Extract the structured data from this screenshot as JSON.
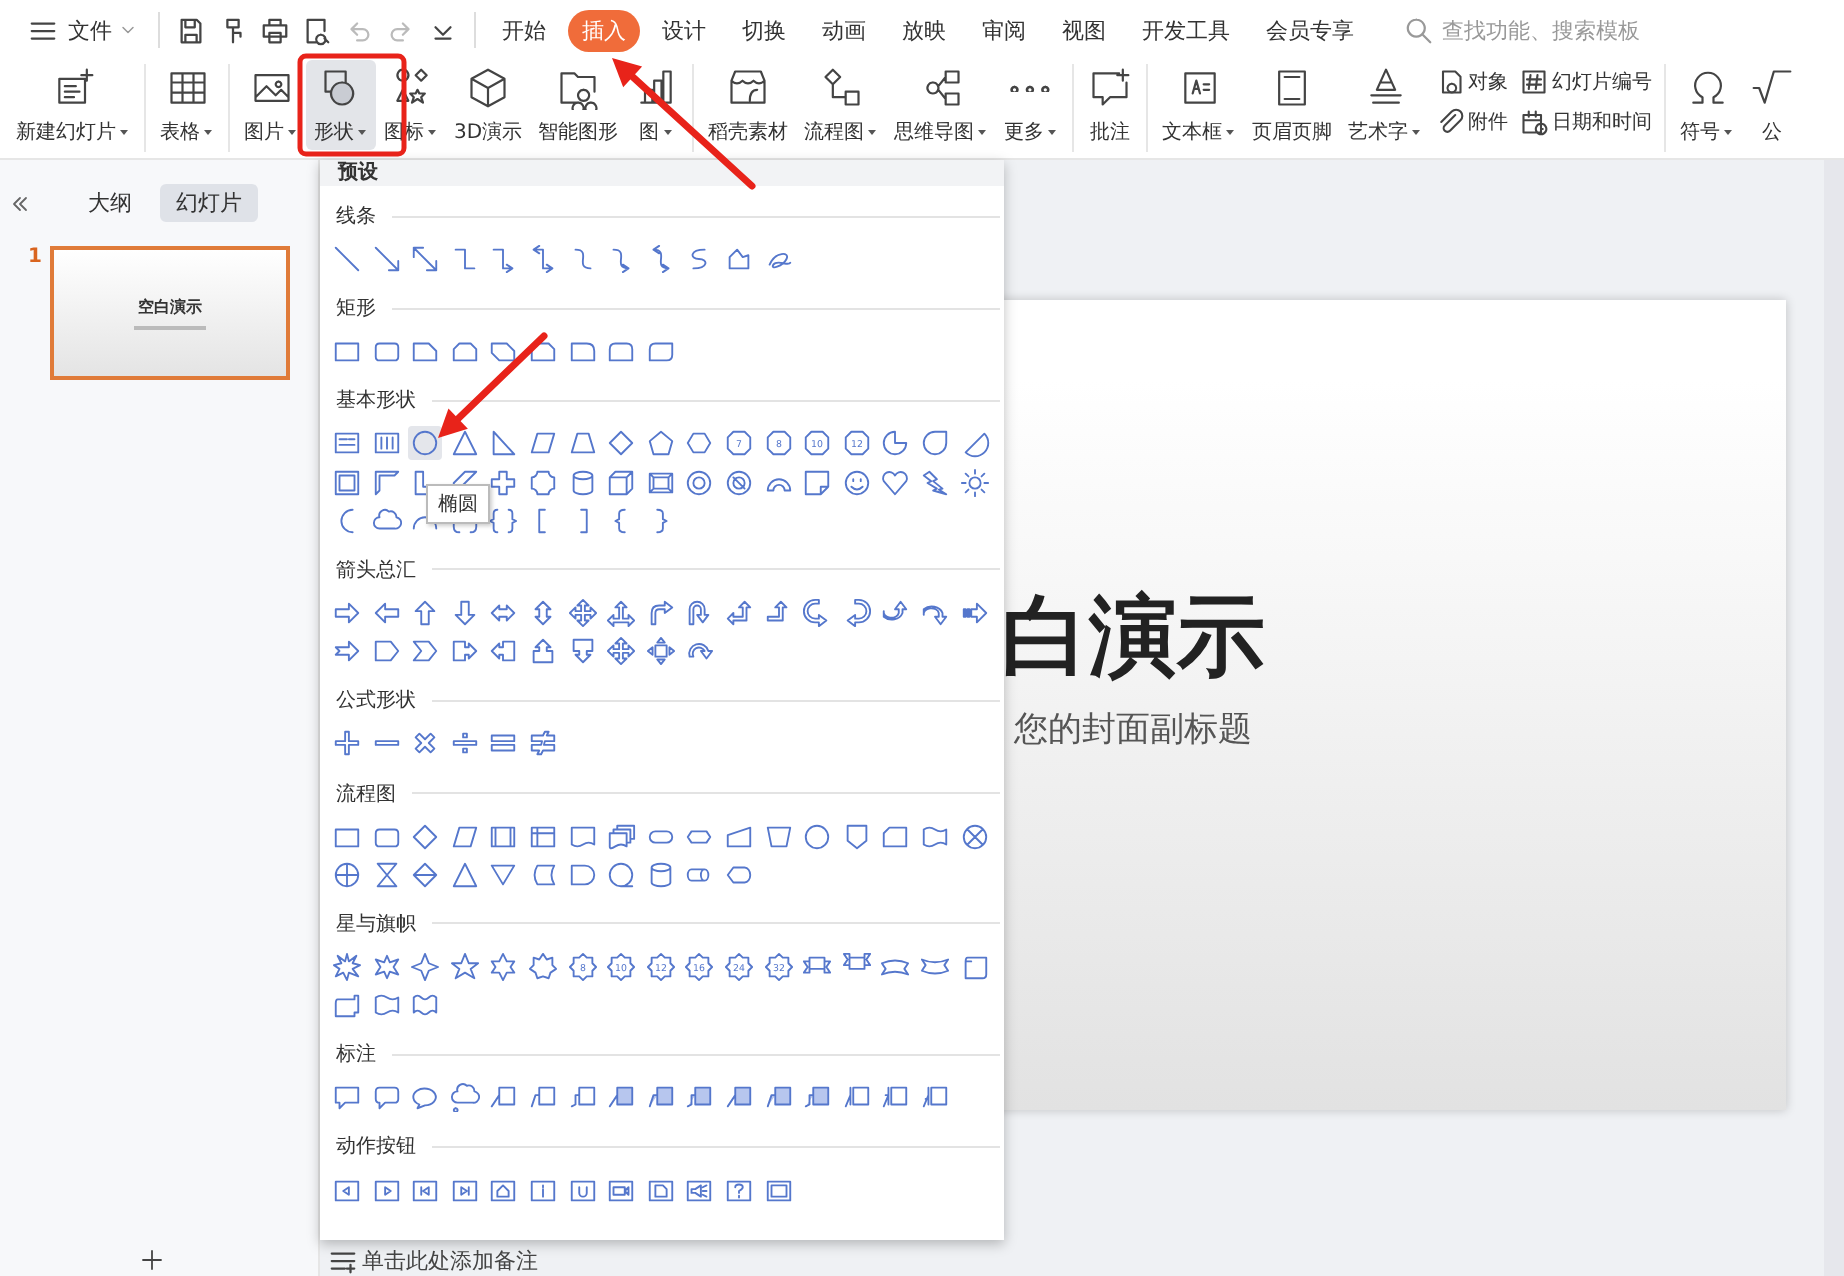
{
  "menu": {
    "label": "文件"
  },
  "quick_access": [
    {
      "disabled": false
    },
    {
      "disabled": false
    },
    {
      "disabled": false
    },
    {
      "disabled": false
    },
    {
      "disabled": true
    },
    {
      "disabled": true
    },
    {
      "disabled": false
    }
  ],
  "tabs": [
    {
      "label": "开始",
      "selected": false
    },
    {
      "label": "插入",
      "selected": true
    },
    {
      "label": "设计",
      "selected": false
    },
    {
      "label": "切换",
      "selected": false
    },
    {
      "label": "动画",
      "selected": false
    },
    {
      "label": "放映",
      "selected": false
    },
    {
      "label": "审阅",
      "selected": false
    },
    {
      "label": "视图",
      "selected": false
    },
    {
      "label": "开发工具",
      "selected": false
    },
    {
      "label": "会员专享",
      "selected": false
    }
  ],
  "search": {
    "placeholder": "查找功能、搜索模板"
  },
  "ribbon": {
    "items": [
      {
        "kind": "large",
        "label": "新建幻灯片",
        "dropdown": true,
        "active": false
      },
      {
        "kind": "separator"
      },
      {
        "kind": "large",
        "label": "表格",
        "dropdown": true,
        "active": false
      },
      {
        "kind": "separator"
      },
      {
        "kind": "large",
        "label": "图片",
        "dropdown": true,
        "active": false
      },
      {
        "kind": "large",
        "label": "形状",
        "dropdown": true,
        "active": true
      },
      {
        "kind": "large",
        "label": "图标",
        "dropdown": true,
        "active": false
      },
      {
        "kind": "large",
        "label": "3D演示",
        "dropdown": false,
        "active": false
      },
      {
        "kind": "large",
        "label": "智能图形",
        "dropdown": false,
        "active": false
      },
      {
        "kind": "large",
        "label": "图",
        "dropdown": true,
        "active": false
      },
      {
        "kind": "separator"
      },
      {
        "kind": "large",
        "label": "稻壳素材",
        "dropdown": false,
        "active": false
      },
      {
        "kind": "large",
        "label": "流程图",
        "dropdown": true,
        "active": false
      },
      {
        "kind": "large",
        "label": "思维导图",
        "dropdown": true,
        "active": false
      },
      {
        "kind": "large",
        "label": "更多",
        "dropdown": true,
        "active": false
      },
      {
        "kind": "separator"
      },
      {
        "kind": "large",
        "label": "批注",
        "dropdown": false,
        "active": false
      },
      {
        "kind": "separator"
      },
      {
        "kind": "large",
        "label": "文本框",
        "dropdown": true,
        "active": false
      },
      {
        "kind": "large",
        "label": "页眉页脚",
        "dropdown": false,
        "active": false
      },
      {
        "kind": "large",
        "label": "艺术字",
        "dropdown": true,
        "active": false
      },
      {
        "kind": "pair",
        "items": [
          {
            "label": "对象"
          },
          {
            "label": "附件"
          }
        ]
      },
      {
        "kind": "pair",
        "items": [
          {
            "label": "幻灯片编号"
          },
          {
            "label": "日期和时间"
          }
        ]
      },
      {
        "kind": "separator"
      },
      {
        "kind": "large",
        "label": "符号",
        "dropdown": true,
        "active": false
      },
      {
        "kind": "large",
        "label": "公",
        "dropdown": false,
        "active": false
      }
    ]
  },
  "side_panel": {
    "tabs": [
      {
        "label": "大纲",
        "selected": false
      },
      {
        "label": "幻灯片",
        "selected": true
      }
    ],
    "slides": [
      {
        "number": "1",
        "title": "空白演示",
        "selected": true
      }
    ]
  },
  "slide": {
    "title": "白演示",
    "subtitle": "您的封面副标题"
  },
  "notes": {
    "placeholder": "单击此处添加备注"
  },
  "shapes_panel": {
    "header": "预设",
    "tooltip": "椭圆",
    "sections": [
      {
        "label": "线条",
        "shapes": [
          {
            "kind": "line"
          },
          {
            "kind": "arrow-line"
          },
          {
            "kind": "double-arrow-line"
          },
          {
            "kind": "elbow"
          },
          {
            "kind": "elbow-arrow"
          },
          {
            "kind": "elbow-double-arrow"
          },
          {
            "kind": "curve"
          },
          {
            "kind": "curve-arrow"
          },
          {
            "kind": "curve-double-arrow"
          },
          {
            "kind": "s-curve"
          },
          {
            "kind": "freeform"
          },
          {
            "kind": "scribble"
          }
        ]
      },
      {
        "label": "矩形",
        "shapes": [
          {
            "kind": "rect"
          },
          {
            "kind": "round-rect"
          },
          {
            "kind": "snip-rect"
          },
          {
            "kind": "snip-two"
          },
          {
            "kind": "snip-diag"
          },
          {
            "kind": "round-snip"
          },
          {
            "kind": "round-one"
          },
          {
            "kind": "round-two"
          },
          {
            "kind": "round-diag"
          }
        ]
      },
      {
        "label": "基本形状",
        "shapes": [
          {
            "kind": "text-box"
          },
          {
            "kind": "vertical-text-box"
          },
          {
            "kind": "circle",
            "hovered": true
          },
          {
            "kind": "triangle"
          },
          {
            "kind": "right-triangle"
          },
          {
            "kind": "parallelogram"
          },
          {
            "kind": "trapezoid"
          },
          {
            "kind": "diamond"
          },
          {
            "kind": "pentagon"
          },
          {
            "kind": "hexagon"
          },
          {
            "kind": "badge",
            "label": "7"
          },
          {
            "kind": "badge",
            "label": "8"
          },
          {
            "kind": "badge",
            "label": "10"
          },
          {
            "kind": "badge",
            "label": "12"
          },
          {
            "kind": "pie"
          },
          {
            "kind": "teardrop"
          },
          {
            "kind": "chord"
          },
          {
            "kind": "frame"
          },
          {
            "kind": "half-frame"
          },
          {
            "kind": "l-shape"
          },
          {
            "kind": "diagonal-stripe"
          },
          {
            "kind": "plus-shape"
          },
          {
            "kind": "plaque"
          },
          {
            "kind": "can"
          },
          {
            "kind": "cube"
          },
          {
            "kind": "bevel"
          },
          {
            "kind": "donut"
          },
          {
            "kind": "no-symbol"
          },
          {
            "kind": "block-arc"
          },
          {
            "kind": "folded-corner"
          },
          {
            "kind": "smiley"
          },
          {
            "kind": "heart"
          },
          {
            "kind": "lightning"
          },
          {
            "kind": "sun"
          },
          {
            "kind": "moon"
          },
          {
            "kind": "cloud"
          },
          {
            "kind": "arc"
          },
          {
            "kind": "bracket-pair"
          },
          {
            "kind": "brace-pair"
          },
          {
            "kind": "left-bracket"
          },
          {
            "kind": "right-bracket"
          },
          {
            "kind": "left-brace"
          },
          {
            "kind": "right-brace"
          }
        ]
      },
      {
        "label": "箭头总汇",
        "shapes": [
          {
            "kind": "arrow-right"
          },
          {
            "kind": "arrow-left"
          },
          {
            "kind": "arrow-up"
          },
          {
            "kind": "arrow-down"
          },
          {
            "kind": "arrow-left-right"
          },
          {
            "kind": "arrow-up-down"
          },
          {
            "kind": "arrow-quad"
          },
          {
            "kind": "arrow-three-way"
          },
          {
            "kind": "bent-arrow"
          },
          {
            "kind": "u-turn-arrow"
          },
          {
            "kind": "left-up-arrow"
          },
          {
            "kind": "bent-up-arrow"
          },
          {
            "kind": "curved-right-arrow"
          },
          {
            "kind": "curved-left-arrow"
          },
          {
            "kind": "curved-up-arrow"
          },
          {
            "kind": "curved-down-arrow"
          },
          {
            "kind": "striped-right-arrow"
          },
          {
            "kind": "notched-right-arrow"
          },
          {
            "kind": "pentagon-arrow"
          },
          {
            "kind": "chevron"
          },
          {
            "kind": "callout-right-arrow"
          },
          {
            "kind": "callout-left-arrow"
          },
          {
            "kind": "callout-up-arrow"
          },
          {
            "kind": "callout-down-arrow"
          },
          {
            "kind": "arrow-quad"
          },
          {
            "kind": "callout-quad-arrow"
          },
          {
            "kind": "circular-arrow"
          }
        ]
      },
      {
        "label": "公式形状",
        "shapes": [
          {
            "kind": "plus-sign"
          },
          {
            "kind": "minus-sign"
          },
          {
            "kind": "multiply-sign"
          },
          {
            "kind": "divide-sign"
          },
          {
            "kind": "equal-sign"
          },
          {
            "kind": "not-equal-sign"
          }
        ]
      },
      {
        "label": "流程图",
        "shapes": [
          {
            "kind": "rect"
          },
          {
            "kind": "round-rect"
          },
          {
            "kind": "diamond"
          },
          {
            "kind": "parallelogram"
          },
          {
            "kind": "predefined-process"
          },
          {
            "kind": "internal-storage"
          },
          {
            "kind": "document"
          },
          {
            "kind": "multi-document"
          },
          {
            "kind": "terminator"
          },
          {
            "kind": "prep-hexagon"
          },
          {
            "kind": "manual-input"
          },
          {
            "kind": "manual-op"
          },
          {
            "kind": "circle"
          },
          {
            "kind": "offpage"
          },
          {
            "kind": "card"
          },
          {
            "kind": "punched-tape"
          },
          {
            "kind": "summing-junction"
          },
          {
            "kind": "or-junction"
          },
          {
            "kind": "collate"
          },
          {
            "kind": "sort"
          },
          {
            "kind": "triangle"
          },
          {
            "kind": "triangle-down"
          },
          {
            "kind": "stored-data"
          },
          {
            "kind": "delay"
          },
          {
            "kind": "sequential"
          },
          {
            "kind": "can"
          },
          {
            "kind": "direct-access"
          },
          {
            "kind": "display"
          }
        ]
      },
      {
        "label": "星与旗帜",
        "shapes": [
          {
            "kind": "burst"
          },
          {
            "kind": "burst-small"
          },
          {
            "kind": "star4"
          },
          {
            "kind": "star5"
          },
          {
            "kind": "star6"
          },
          {
            "kind": "seal"
          },
          {
            "kind": "star-badge",
            "label": "8"
          },
          {
            "kind": "star-badge",
            "label": "10"
          },
          {
            "kind": "star-badge",
            "label": "12"
          },
          {
            "kind": "star-badge",
            "label": "16"
          },
          {
            "kind": "star-badge",
            "label": "24"
          },
          {
            "kind": "star-badge",
            "label": "32"
          },
          {
            "kind": "ribbon-down"
          },
          {
            "kind": "ribbon-up"
          },
          {
            "kind": "curved-ribbon-down"
          },
          {
            "kind": "curved-ribbon-up"
          },
          {
            "kind": "scroll-vertical"
          },
          {
            "kind": "scroll-horizontal"
          },
          {
            "kind": "wave"
          },
          {
            "kind": "double-wave"
          }
        ]
      },
      {
        "label": "标注",
        "shapes": [
          {
            "kind": "speech-rect"
          },
          {
            "kind": "speech-round"
          },
          {
            "kind": "speech-oval"
          },
          {
            "kind": "speech-cloud"
          },
          {
            "kind": "line-callout"
          },
          {
            "kind": "bent-line-callout"
          },
          {
            "kind": "double-line-callout"
          },
          {
            "kind": "line-callout-filled"
          },
          {
            "kind": "bent-line-callout-filled"
          },
          {
            "kind": "double-line-callout-filled"
          },
          {
            "kind": "line-callout-shaded"
          },
          {
            "kind": "bent-line-callout-shaded"
          },
          {
            "kind": "double-line-callout-shaded"
          },
          {
            "kind": "accent-callout"
          },
          {
            "kind": "bent-accent-callout"
          },
          {
            "kind": "double-accent-callout"
          }
        ]
      },
      {
        "label": "动作按钮",
        "shapes": [
          {
            "kind": "action-back"
          },
          {
            "kind": "action-forward"
          },
          {
            "kind": "action-start"
          },
          {
            "kind": "action-end"
          },
          {
            "kind": "action-home"
          },
          {
            "kind": "action-info"
          },
          {
            "kind": "action-return"
          },
          {
            "kind": "action-movie"
          },
          {
            "kind": "action-document"
          },
          {
            "kind": "action-sound"
          },
          {
            "kind": "action-help"
          },
          {
            "kind": "action-blank"
          }
        ]
      }
    ]
  },
  "annotations": [
    {
      "kind": "highlight-box"
    },
    {
      "kind": "arrow"
    },
    {
      "kind": "arrow"
    }
  ]
}
